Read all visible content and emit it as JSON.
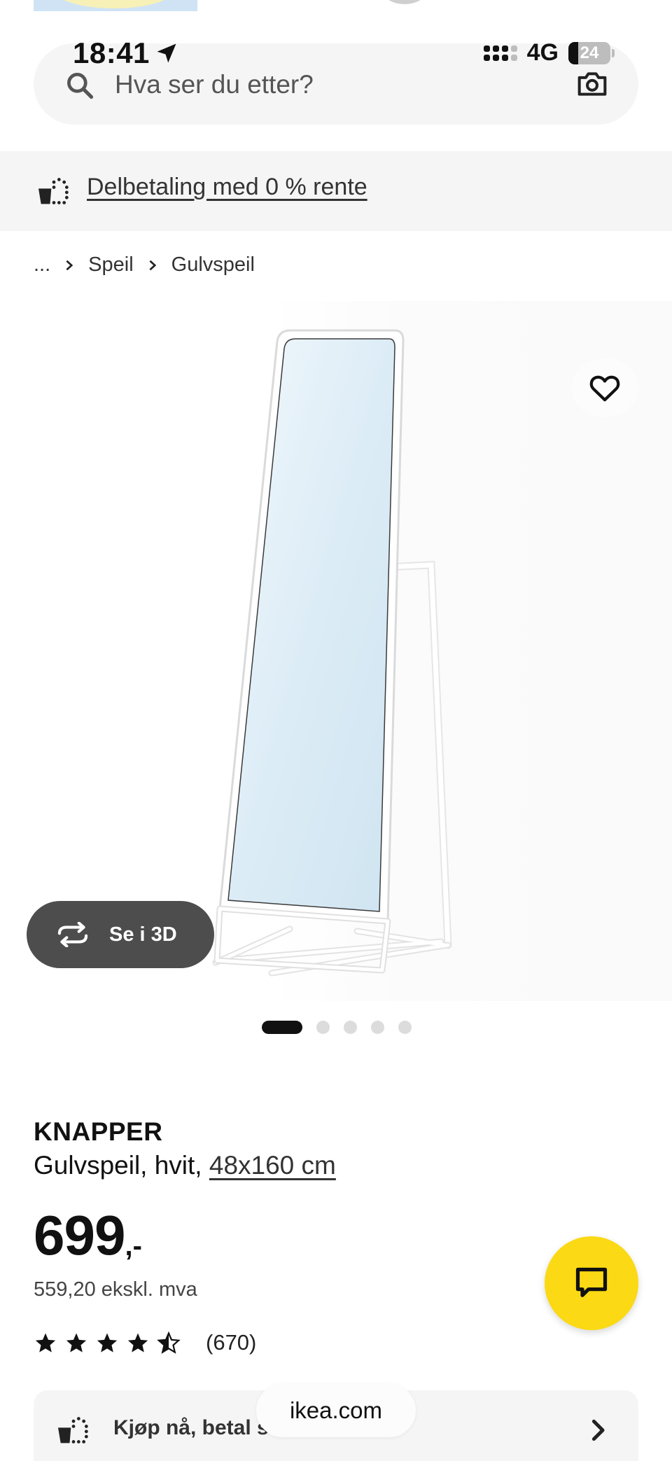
{
  "status_bar": {
    "time": "18:41",
    "network": "4G",
    "battery": "24"
  },
  "search": {
    "placeholder": "Hva ser du etter?"
  },
  "promo": {
    "link_text": "Delbetaling med 0 % rente"
  },
  "breadcrumb": {
    "items": [
      "...",
      "Speil",
      "Gulvspeil"
    ]
  },
  "gallery": {
    "view_3d_label": "Se i 3D",
    "slide_count": 5,
    "active_slide": 1
  },
  "product": {
    "name": "KNAPPER",
    "description": "Gulvspeil, hvit,",
    "size_link": "48x160 cm",
    "price_main": "699",
    "price_suffix": ",-",
    "price_ex_vat": "559,20 ekskl. mva",
    "rating_value": 4.5,
    "rating_max": 5,
    "rating_count": "(670)"
  },
  "buy_bar": {
    "label": "Kjøp nå, betal s"
  },
  "browser": {
    "url": "ikea.com"
  },
  "colors": {
    "accent_yellow": "#fbd914",
    "panel_gray": "#f5f5f5",
    "button_dark": "#4d4d4d"
  },
  "icons": [
    "location-arrow-icon",
    "signal-icon",
    "battery-icon",
    "search-icon",
    "camera-icon",
    "installment-icon",
    "chevron-right-icon",
    "heart-icon",
    "rotate-3d-icon",
    "star-icon",
    "chat-icon"
  ]
}
